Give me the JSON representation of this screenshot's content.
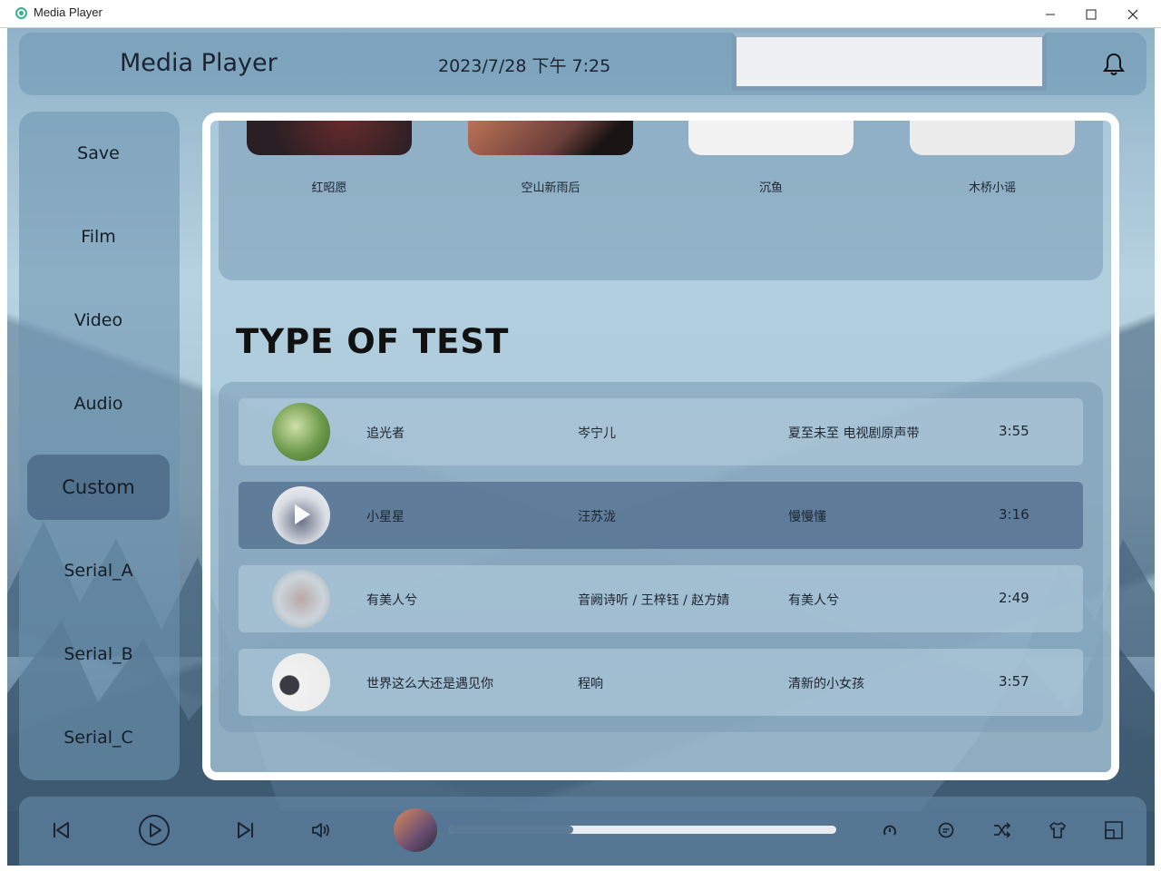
{
  "window": {
    "title": "Media Player",
    "minimize_glyph": "—",
    "maximize_glyph": "☐",
    "close_glyph": "✕"
  },
  "header": {
    "app_title": "Media Player",
    "datetime": "2023/7/28 下午 7:25",
    "search_value": "",
    "icon": "bell-icon"
  },
  "sidebar": {
    "items": [
      {
        "label": "Save"
      },
      {
        "label": "Film"
      },
      {
        "label": "Video"
      },
      {
        "label": "Audio"
      },
      {
        "label": "Custom",
        "active": true
      },
      {
        "label": "Serial_A"
      },
      {
        "label": "Serial_B"
      },
      {
        "label": "Serial_C"
      }
    ]
  },
  "albums": [
    {
      "title": "红昭愿"
    },
    {
      "title": "空山新雨后"
    },
    {
      "title": "沉鱼"
    },
    {
      "title": "木桥小谣"
    }
  ],
  "section_title": "TYPE OF TEST",
  "songs": [
    {
      "title": "追光者",
      "artist": "岑宁儿",
      "album": "夏至未至 电视剧原声带",
      "duration": "3:55"
    },
    {
      "title": "小星星",
      "artist": "汪苏泷",
      "album": "慢慢懂",
      "duration": "3:16",
      "selected": true
    },
    {
      "title": "有美人兮",
      "artist": "音阙诗听 / 王梓钰 / 赵方婧",
      "album": "有美人兮",
      "duration": "2:49"
    },
    {
      "title": "世界这么大还是遇见你",
      "artist": "程响",
      "album": "清新的小女孩",
      "duration": "3:57"
    }
  ],
  "player": {
    "progress_fraction": 0.32,
    "icons": [
      "previous-icon",
      "play-icon",
      "next-icon",
      "volume-icon",
      "loop-icon",
      "lyrics-icon",
      "shuffle-icon",
      "skin-icon",
      "mini-mode-icon"
    ]
  },
  "colors": {
    "accent": "#5a7a96",
    "selected_row": "#50708c",
    "panel": "#6e96b2"
  }
}
